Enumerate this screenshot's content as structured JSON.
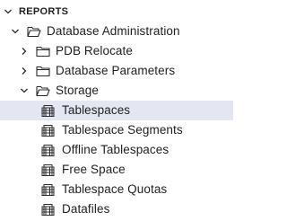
{
  "tree": {
    "header": {
      "label": "REPORTS",
      "icon": "chevron-down-icon",
      "expanded": true
    },
    "database_administration": {
      "label": "Database Administration",
      "icon": "folder-open-icon",
      "expanded": true
    },
    "pdb_relocate": {
      "label": "PDB Relocate",
      "icon": "folder-icon",
      "expanded": false
    },
    "database_parameters": {
      "label": "Database Parameters",
      "icon": "folder-icon",
      "expanded": false
    },
    "storage": {
      "label": "Storage",
      "icon": "folder-open-icon",
      "expanded": true,
      "items": [
        {
          "label": "Tablespaces",
          "icon": "report-grid-icon",
          "selected": true
        },
        {
          "label": "Tablespace Segments",
          "icon": "report-grid-icon"
        },
        {
          "label": "Offline Tablespaces",
          "icon": "report-grid-icon"
        },
        {
          "label": "Free Space",
          "icon": "report-grid-icon"
        },
        {
          "label": "Tablespace Quotas",
          "icon": "report-grid-icon"
        },
        {
          "label": "Datafiles",
          "icon": "report-grid-icon"
        }
      ]
    }
  },
  "colors": {
    "selected_background": "#e4e7f1",
    "text": "#1f1f1f",
    "icon_stroke": "#2b2b2b"
  }
}
